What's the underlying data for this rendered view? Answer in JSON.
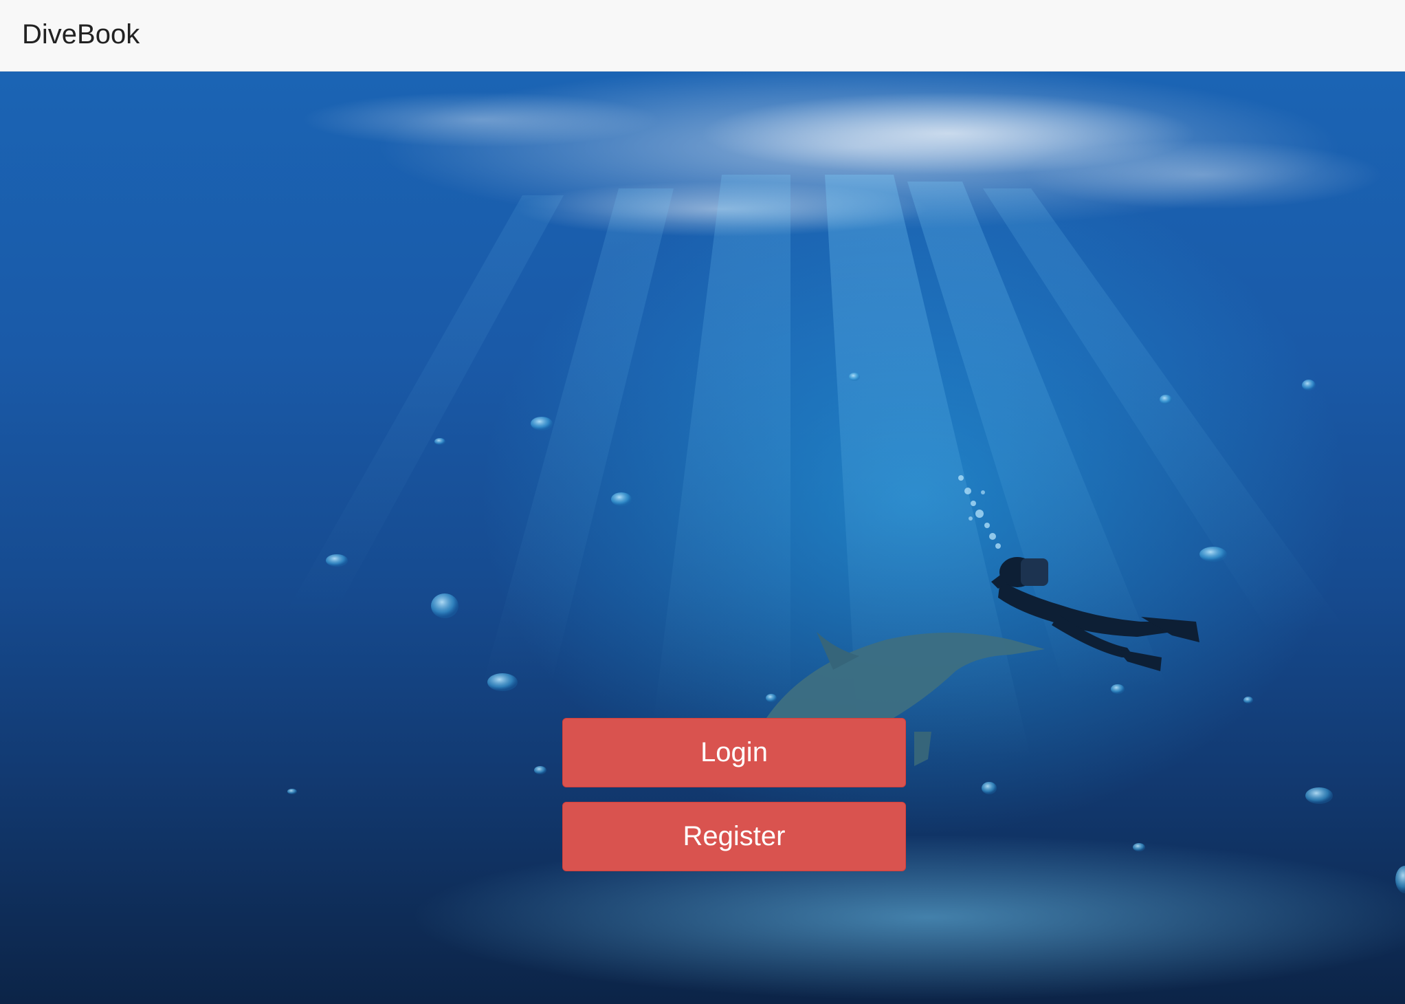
{
  "navbar": {
    "brand": "DiveBook"
  },
  "hero": {
    "image": "underwater-diver-dolphin-background",
    "actions": {
      "login_label": "Login",
      "register_label": "Register"
    }
  },
  "colors": {
    "navbar_bg": "#f8f8f8",
    "button_bg": "#d9534f",
    "button_text": "#ffffff",
    "ocean_top": "#1b64b4",
    "ocean_bottom": "#0c2447"
  }
}
